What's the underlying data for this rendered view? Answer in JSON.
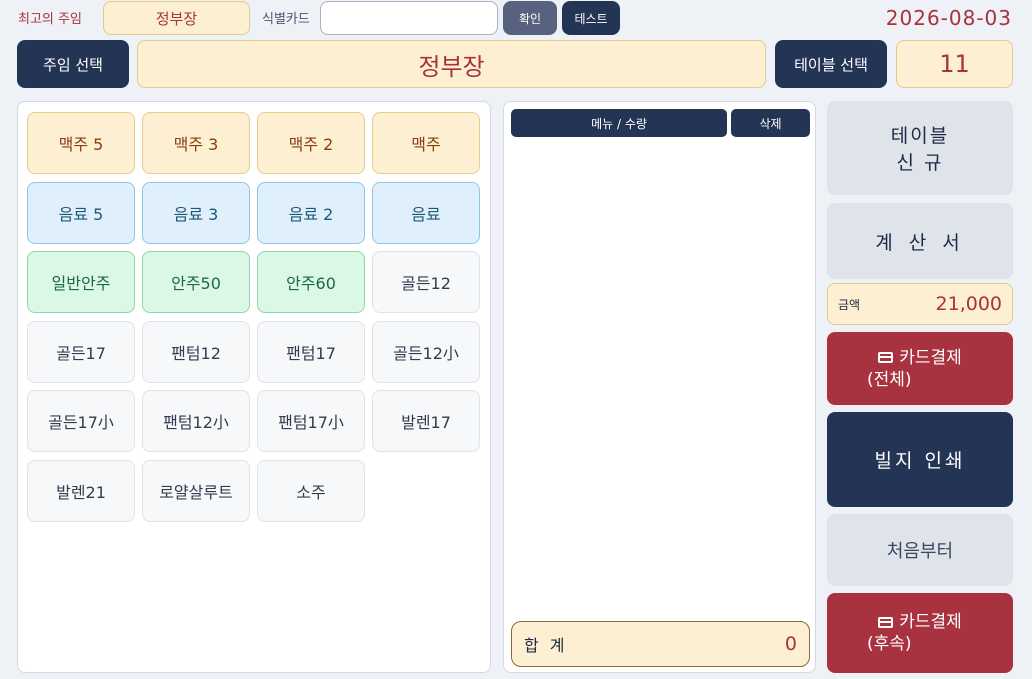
{
  "header": {
    "recent_boss_label": "최고의 주임",
    "recent_boss_value": "정부장",
    "id_card_label": "식별카드",
    "id_card_value": "",
    "confirm_label": "확인",
    "test_label": "테스트",
    "date": "2026-08-03"
  },
  "selection": {
    "boss_select_label": "주임 선택",
    "boss_name": "정부장",
    "table_select_label": "테이블 선택",
    "table_number": "11"
  },
  "menu": {
    "items": [
      {
        "label": "맥주 5",
        "kind": "beer"
      },
      {
        "label": "맥주 3",
        "kind": "beer"
      },
      {
        "label": "맥주 2",
        "kind": "beer"
      },
      {
        "label": "맥주",
        "kind": "beer"
      },
      {
        "label": "음료 5",
        "kind": "drink"
      },
      {
        "label": "음료 3",
        "kind": "drink"
      },
      {
        "label": "음료 2",
        "kind": "drink"
      },
      {
        "label": "음료",
        "kind": "drink"
      },
      {
        "label": "일반안주",
        "kind": "snack"
      },
      {
        "label": "안주50",
        "kind": "snack"
      },
      {
        "label": "안주60",
        "kind": "snack"
      },
      {
        "label": "골든12",
        "kind": "other"
      },
      {
        "label": "골든17",
        "kind": "other"
      },
      {
        "label": "팬텀12",
        "kind": "other"
      },
      {
        "label": "팬텀17",
        "kind": "other"
      },
      {
        "label": "골든12小",
        "kind": "other"
      },
      {
        "label": "골든17小",
        "kind": "other"
      },
      {
        "label": "팬텀12小",
        "kind": "other"
      },
      {
        "label": "팬텀17小",
        "kind": "other"
      },
      {
        "label": "발렌17",
        "kind": "other"
      },
      {
        "label": "발렌21",
        "kind": "other"
      },
      {
        "label": "로얄살루트",
        "kind": "other"
      },
      {
        "label": "소주",
        "kind": "other"
      }
    ]
  },
  "order": {
    "col_menu_qty": "메뉴 / 수량",
    "col_delete": "삭제",
    "rows": [],
    "total_label": "합 계",
    "total_value": "0"
  },
  "actions": {
    "new_table_line1": "테이블",
    "new_table_line2": "신 규",
    "bill_label": "계 산 서",
    "amount_label": "금액",
    "amount_value": "21,000",
    "card_full_line1": "카드결제",
    "card_full_line2": "(전체)",
    "print_slip_label": "빌지 인쇄",
    "from_start_label": "처음부터",
    "card_later_line1": "카드결제",
    "card_later_line2": "(후속)"
  },
  "colors": {
    "navy": "#243454",
    "accent_red": "#a8323f",
    "cream": "#fcefd2"
  }
}
